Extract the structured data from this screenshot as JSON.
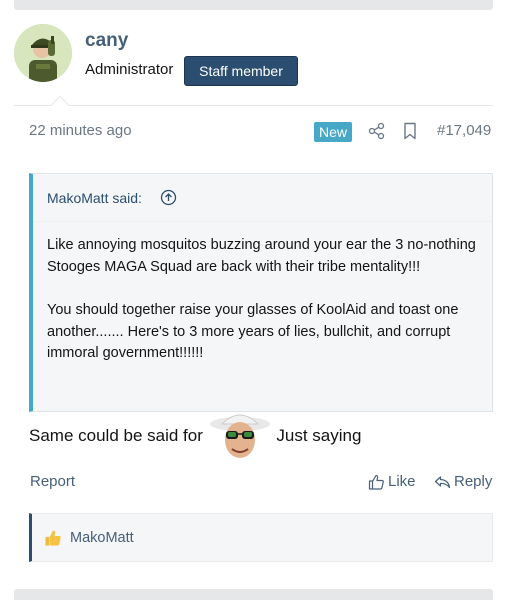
{
  "author": {
    "username": "cany",
    "title": "Administrator",
    "staff_badge": "Staff member",
    "avatar_icon": "soldier-avatar"
  },
  "post": {
    "date": "22 minutes ago",
    "new_badge": "New",
    "share_icon": "share-icon",
    "bookmark_icon": "bookmark-icon",
    "number": "#17,049",
    "text_before": "Same could be said for",
    "text_after": "Just saying",
    "smiley_icon": "sunglasses-guy-smiley"
  },
  "quote": {
    "author": "MakoMatt said:",
    "paragraphs": [
      "Like annoying mosquitos buzzing around your ear the 3 no-nothing Stooges MAGA Squad are back with their tribe mentality!!!",
      "You should together raise your glasses of KoolAid and toast one another....... Here's to 3 more years of lies, bullchit, and corrupt immoral government!!!!!!"
    ]
  },
  "actions": {
    "report": "Report",
    "like": "Like",
    "reply": "Reply"
  },
  "likes": {
    "user": "MakoMatt"
  },
  "colors": {
    "accent": "#47a7c7",
    "link": "#47607a",
    "staff_badge_bg": "#2b4d6f"
  }
}
